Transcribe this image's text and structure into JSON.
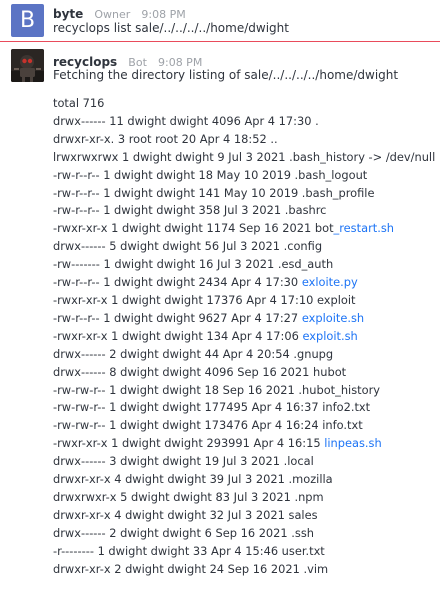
{
  "message1": {
    "avatar_letter": "B",
    "author": "byte",
    "role": "Owner",
    "time": "9:08 PM",
    "text": "recyclops list sale/../../../../home/dwight"
  },
  "message2": {
    "avatar_icon": "bot-avatar-image",
    "author": "recyclops",
    "role": "Bot",
    "time": "9:08 PM",
    "text": "Fetching the directory listing of sale/../../../../home/dwight",
    "rows": [
      {
        "text": "total 716",
        "link": ""
      },
      {
        "text": "drwx------ 11 dwight dwight 4096 Apr 4 17:30 .",
        "link": ""
      },
      {
        "text": "drwxr-xr-x. 3 root root 20 Apr 4 18:52 ..",
        "link": ""
      },
      {
        "text": "lrwxrwxrwx 1 dwight dwight 9 Jul 3 2021 .bash_history -> /dev/null",
        "link": ""
      },
      {
        "text": "-rw-r--r-- 1 dwight dwight 18 May 10 2019 .bash_logout",
        "link": ""
      },
      {
        "text": "-rw-r--r-- 1 dwight dwight 141 May 10 2019 .bash_profile",
        "link": ""
      },
      {
        "text": "-rw-r--r-- 1 dwight dwight 358 Jul 3 2021 .bashrc",
        "link": ""
      },
      {
        "text": "-rwxr-xr-x 1 dwight dwight 1174 Sep 16 2021 bot",
        "link": "_restart.sh"
      },
      {
        "text": "drwx------ 5 dwight dwight 56 Jul 3 2021 .config",
        "link": ""
      },
      {
        "text": "-rw------- 1 dwight dwight 16 Jul 3 2021 .esd_auth",
        "link": ""
      },
      {
        "text": "-rw-r--r-- 1 dwight dwight 2434 Apr 4 17:30 ",
        "link": "exloite.py"
      },
      {
        "text": "-rwxr-xr-x 1 dwight dwight 17376 Apr 4 17:10 exploit",
        "link": ""
      },
      {
        "text": "-rw-r--r-- 1 dwight dwight 9627 Apr 4 17:27 ",
        "link": "exploite.sh"
      },
      {
        "text": "-rwxr-xr-x 1 dwight dwight 134 Apr 4 17:06 ",
        "link": "exploit.sh"
      },
      {
        "text": "drwx------ 2 dwight dwight 44 Apr 4 20:54 .gnupg",
        "link": ""
      },
      {
        "text": "drwx------ 8 dwight dwight 4096 Sep 16 2021 hubot",
        "link": ""
      },
      {
        "text": "-rw-rw-r-- 1 dwight dwight 18 Sep 16 2021 .hubot_history",
        "link": ""
      },
      {
        "text": "-rw-rw-r-- 1 dwight dwight 177495 Apr 4 16:37 info2.txt",
        "link": ""
      },
      {
        "text": "-rw-rw-r-- 1 dwight dwight 173476 Apr 4 16:24 info.txt",
        "link": ""
      },
      {
        "text": "-rwxr-xr-x 1 dwight dwight 293991 Apr 4 16:15 ",
        "link": "linpeas.sh"
      },
      {
        "text": "drwx------ 3 dwight dwight 19 Jul 3 2021 .local",
        "link": ""
      },
      {
        "text": "drwxr-xr-x 4 dwight dwight 39 Jul 3 2021 .mozilla",
        "link": ""
      },
      {
        "text": "drwxrwxr-x 5 dwight dwight 83 Jul 3 2021 .npm",
        "link": ""
      },
      {
        "text": "drwxr-xr-x 4 dwight dwight 32 Jul 3 2021 sales",
        "link": ""
      },
      {
        "text": "drwx------ 2 dwight dwight 6 Sep 16 2021 .ssh",
        "link": ""
      },
      {
        "text": "-r-------- 1 dwight dwight 33 Apr 4 15:46 user.txt",
        "link": ""
      },
      {
        "text": "drwxr-xr-x 2 dwight dwight 24 Sep 16 2021 .vim",
        "link": ""
      }
    ]
  }
}
